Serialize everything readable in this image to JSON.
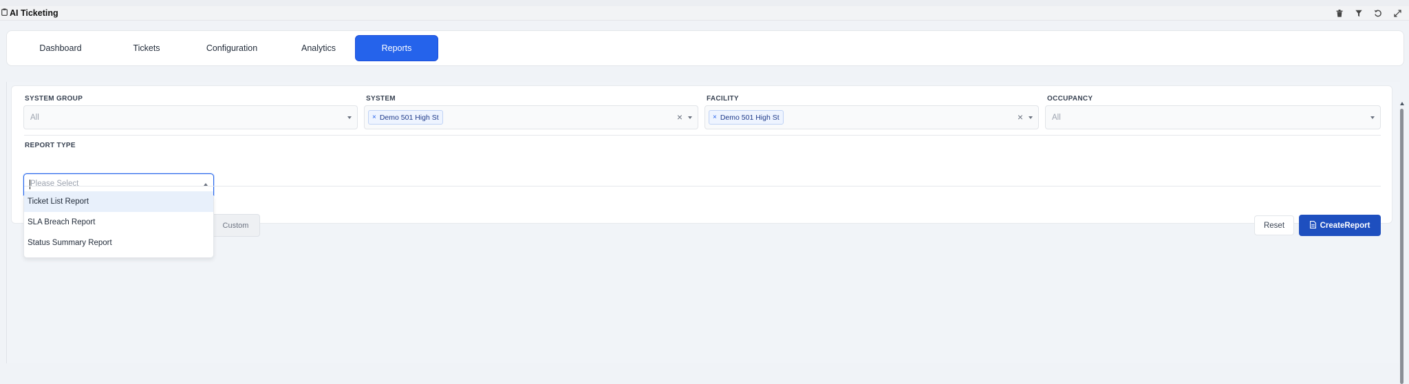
{
  "app": {
    "title": "AI Ticketing"
  },
  "title_actions": [
    "trash-icon",
    "filter-icon",
    "refresh-icon",
    "expand-icon"
  ],
  "tabs": [
    {
      "label": "Dashboard",
      "active": false
    },
    {
      "label": "Tickets",
      "active": false
    },
    {
      "label": "Configuration",
      "active": false
    },
    {
      "label": "Analytics",
      "active": false
    },
    {
      "label": "Reports",
      "active": true
    }
  ],
  "filters": {
    "system_group": {
      "label": "SYSTEM GROUP",
      "value": "All"
    },
    "system": {
      "label": "SYSTEM",
      "chip": "Demo 501 High St",
      "chip_remove": "×",
      "clear": "×"
    },
    "facility": {
      "label": "FACILITY",
      "chip": "Demo 501 High St",
      "chip_remove": "×",
      "clear": "×"
    },
    "occupancy": {
      "label": "OCCUPANCY",
      "value": "All"
    }
  },
  "report_type": {
    "label": "REPORT TYPE",
    "placeholder": "Please Select",
    "options": [
      "Ticket List Report",
      "SLA Breach Report",
      "Status Summary Report"
    ],
    "highlighted_index": 0
  },
  "actions": {
    "custom": "Custom",
    "reset": "Reset",
    "create": "CreateReport"
  },
  "colors": {
    "accent": "#2563eb",
    "create_button": "#1e4fbf",
    "background": "#f0f3f7"
  }
}
